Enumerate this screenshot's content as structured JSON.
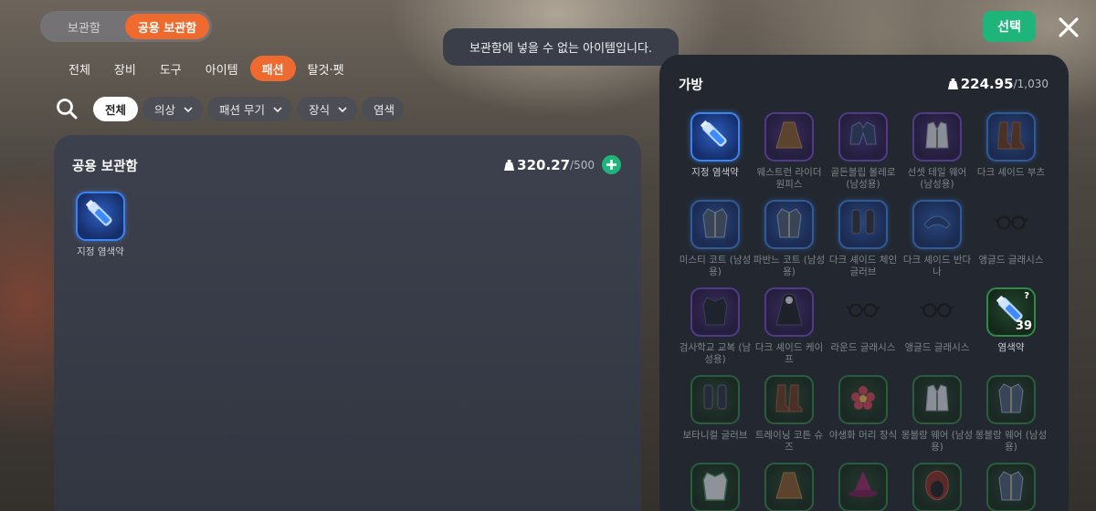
{
  "top_switch": {
    "storage": "보관함",
    "shared_storage": "공용 보관함"
  },
  "category_tabs": [
    "전체",
    "장비",
    "도구",
    "아이템",
    "패션",
    "탈것·펫"
  ],
  "filters": {
    "all": "전체",
    "clothing": "의상",
    "fashion_weapon": "패션 무기",
    "accessory": "장식",
    "dye": "염색"
  },
  "toast": "보관함에 넣을 수 없는 아이템입니다.",
  "select_button": "선택",
  "shared_storage_panel": {
    "title": "공용 보관함",
    "weight": "320.27",
    "capacity": "/500",
    "items": [
      {
        "label": "지정 염색약",
        "rarity": "blue",
        "icon": "dye-bottle-icon"
      }
    ]
  },
  "bag_panel": {
    "title": "가방",
    "weight": "224.95",
    "capacity": "/1,030",
    "items": [
      {
        "label": "지정 염색약",
        "rarity": "blue",
        "icon": "dye-bottle-icon",
        "dim": false
      },
      {
        "label": "웨스트런 라이더 원피스",
        "rarity": "purple",
        "icon": "dress-icon",
        "dim": true
      },
      {
        "label": "골든블립 볼레로 (남성용)",
        "rarity": "purple",
        "icon": "bolero-icon",
        "dim": true
      },
      {
        "label": "선셋 테일 웨어 (남성용)",
        "rarity": "purple",
        "icon": "suit-icon",
        "dim": true
      },
      {
        "label": "다크 셰이드 부츠",
        "rarity": "blue",
        "icon": "boots-icon",
        "dim": true
      },
      {
        "label": "미스티 코트 (남성용)",
        "rarity": "blue",
        "icon": "coat-icon",
        "dim": true
      },
      {
        "label": "파반느 코트 (남성용)",
        "rarity": "blue",
        "icon": "coat-icon",
        "dim": true
      },
      {
        "label": "다크 셰이드 체인 글러브",
        "rarity": "blue",
        "icon": "gloves-icon",
        "dim": true
      },
      {
        "label": "다크 셰이드 반다나",
        "rarity": "blue",
        "icon": "bandana-icon",
        "dim": true
      },
      {
        "label": "앵글드 글래시스",
        "rarity": "plain",
        "icon": "glasses-icon",
        "dim": true
      },
      {
        "label": "검사학교 교복 (남성용)",
        "rarity": "purple",
        "icon": "uniform-icon",
        "dim": true
      },
      {
        "label": "다크 셰이드 케이프",
        "rarity": "purple",
        "icon": "cape-icon",
        "dim": true
      },
      {
        "label": "라운드 글래시스",
        "rarity": "plain",
        "icon": "glasses-icon",
        "dim": true
      },
      {
        "label": "앵글드 글래시스",
        "rarity": "plain",
        "icon": "glasses-icon",
        "dim": true
      },
      {
        "label": "염색약",
        "rarity": "green",
        "icon": "dye-bottle-icon",
        "dim": false,
        "qty": "39",
        "mark": "?"
      },
      {
        "label": "보타니컬 글러브",
        "rarity": "green",
        "icon": "gloves-icon",
        "dim": true
      },
      {
        "label": "트레이닝 코튼 슈즈",
        "rarity": "green",
        "icon": "boots-icon",
        "dim": true
      },
      {
        "label": "야생화 머리 장식",
        "rarity": "green",
        "icon": "flower-icon",
        "dim": true
      },
      {
        "label": "몽블랑 웨어 (남성용)",
        "rarity": "green",
        "icon": "suit-icon",
        "dim": true
      },
      {
        "label": "몽블랑 웨어 (남성용)",
        "rarity": "green",
        "icon": "coat-icon",
        "dim": true
      },
      {
        "label": "",
        "rarity": "green",
        "icon": "jacket-icon",
        "dim": true
      },
      {
        "label": "",
        "rarity": "green",
        "icon": "dress-icon",
        "dim": true
      },
      {
        "label": "",
        "rarity": "green",
        "icon": "hat-icon",
        "dim": true
      },
      {
        "label": "",
        "rarity": "green",
        "icon": "hood-icon",
        "dim": true
      },
      {
        "label": "",
        "rarity": "green",
        "icon": "coat-icon",
        "dim": true
      }
    ]
  },
  "colors": {
    "accent": "#ef6a2e",
    "select_green": "#1fb57a",
    "rare_blue": "#3b83f0",
    "epic_purple": "#7a4ad6",
    "common_green": "#2f8a45"
  }
}
